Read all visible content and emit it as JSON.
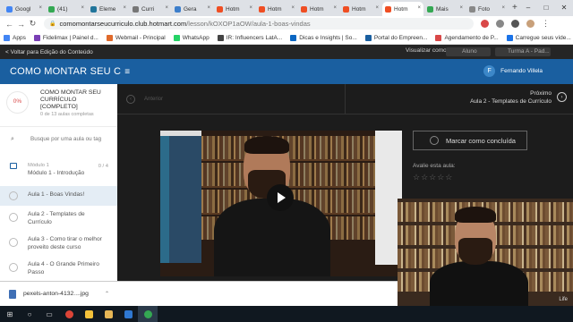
{
  "browser": {
    "tabs": [
      {
        "label": "Googl",
        "color": "#4285f4"
      },
      {
        "label": "(41)",
        "color": "#34a853"
      },
      {
        "label": "Eleme",
        "color": "#21759b"
      },
      {
        "label": "Curri",
        "color": "#777777"
      },
      {
        "label": "Gera",
        "color": "#3c7ecb"
      },
      {
        "label": "Hotm",
        "color": "#ef4e23"
      },
      {
        "label": "Hotm",
        "color": "#ef4e23"
      },
      {
        "label": "Hotm",
        "color": "#ef4e23"
      },
      {
        "label": "Hotm",
        "color": "#ef4e23"
      },
      {
        "label": "Hotm",
        "color": "#ef4e23"
      },
      {
        "label": "Mais",
        "color": "#34a853"
      },
      {
        "label": "Foto",
        "color": "#888888"
      }
    ],
    "active_tab_index": 9,
    "new_tab_symbol": "+",
    "window_controls": [
      "–",
      "□",
      "✕"
    ],
    "url_host": "comomontarseucurriculo.club.hotmart.com",
    "url_path": "/lesson/kOXOP1aOW/aula-1-boas-vindas",
    "bookmarks": [
      {
        "label": "Apps",
        "color": "#4285f4"
      },
      {
        "label": "Fidelimax | Painel d...",
        "color": "#7a3fb5"
      },
      {
        "label": "Webmail - Principal",
        "color": "#e06a2b"
      },
      {
        "label": "WhatsApp",
        "color": "#25d366"
      },
      {
        "label": "IR: Influencers LatA...",
        "color": "#444444"
      },
      {
        "label": "Dicas e Insights | So...",
        "color": "#0a66c2"
      },
      {
        "label": "Portal do Empreen...",
        "color": "#1a5fa0"
      },
      {
        "label": "Agendamento de P...",
        "color": "#d94848"
      },
      {
        "label": "Carregue seus víde...",
        "color": "#1a73e8"
      }
    ]
  },
  "header": {
    "back_link": "< Voltar para Edição do Conteúdo",
    "view_as_label": "Visualizar como:",
    "view_as_value": "Aluno",
    "class_select": "Turma A - Pad..."
  },
  "course": {
    "title": "COMO MONTAR SEU C",
    "user_name": "Fernando Villela",
    "user_initial": "F",
    "progress_percent": "0%",
    "name": "COMO MONTAR SEU CURRÍCULO [COMPLETO]",
    "lessons_done": "0 de 13 aulas completas",
    "search_placeholder": "Busque por uma aula ou tag",
    "module_label": "Módulo 1",
    "module_name": "Módulo 1 - Introdução",
    "module_count": "0 / 4",
    "lessons": [
      {
        "title": "Aula 1 - Boas Vindas!"
      },
      {
        "title": "Aula 2 - Templates de Currículo"
      },
      {
        "title": "Aula 3 - Como tirar o melhor proveito deste curso"
      },
      {
        "title": "Aula 4 - O Grande Primeiro Passo"
      }
    ]
  },
  "lesson_nav": {
    "previous": "Anterior",
    "next_label": "Próximo",
    "next_lesson": "Aula 2 - Templates de Currículo"
  },
  "actions": {
    "mark_complete": "Marcar como concluída",
    "rate_label": "Avalie esta aula:",
    "stars": "☆☆☆☆☆"
  },
  "download": {
    "filename": "pexels-anton-4132....jpg"
  },
  "webcam": {
    "watermark": "Life"
  }
}
